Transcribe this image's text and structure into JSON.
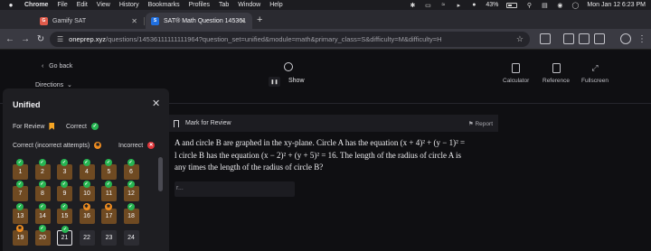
{
  "menubar": {
    "app": "Chrome",
    "items": [
      "File",
      "Edit",
      "View",
      "History",
      "Bookmarks",
      "Profiles",
      "Tab",
      "Window",
      "Help"
    ],
    "battery": "43%",
    "clock": "Mon Jan 12  6:23 PM"
  },
  "tabs": [
    {
      "title": "Gamify SAT",
      "favicon": "G"
    },
    {
      "title": "SAT® Math Question 145361",
      "favicon": "S"
    }
  ],
  "address": {
    "host": "oneprep.xyz",
    "path": "/questions/14536111111111964?question_set=unified&module=math&primary_class=S&difficulty=M&difficulty=H"
  },
  "page": {
    "back": "Go back",
    "directions": "Directions",
    "show": "Show",
    "tools": [
      {
        "icon": "calculator-icon",
        "label": "Calculator"
      },
      {
        "icon": "reference-icon",
        "label": "Reference"
      },
      {
        "icon": "fullscreen-icon",
        "label": "Fullscreen"
      }
    ],
    "mark_for_review": "Mark for Review",
    "report": "Report",
    "question_lines": [
      "A and circle B are graphed in the xy-plane. Circle A has the equation (x + 4)² + (y − 1)² =",
      "l circle B has the equation (x − 2)² + (y + 5)² = 16. The length of the radius of circle A is",
      "any times the length of the radius of circle B?"
    ],
    "answer_placeholder": "r..."
  },
  "panel": {
    "title": "Unified",
    "legend": {
      "for_review": "For Review",
      "correct": "Correct",
      "correct_incorrect_attempts": "Correct (incorrect attempts)",
      "incorrect": "Incorrect"
    },
    "questions": [
      {
        "n": "1",
        "status": "correct"
      },
      {
        "n": "2",
        "status": "correct"
      },
      {
        "n": "3",
        "status": "correct"
      },
      {
        "n": "4",
        "status": "correct"
      },
      {
        "n": "5",
        "status": "correct"
      },
      {
        "n": "6",
        "status": "correct"
      },
      {
        "n": "7",
        "status": "correct"
      },
      {
        "n": "8",
        "status": "correct"
      },
      {
        "n": "9",
        "status": "correct"
      },
      {
        "n": "10",
        "status": "correct"
      },
      {
        "n": "11",
        "status": "correct"
      },
      {
        "n": "12",
        "status": "correct"
      },
      {
        "n": "13",
        "status": "correct"
      },
      {
        "n": "14",
        "status": "correct"
      },
      {
        "n": "15",
        "status": "correct"
      },
      {
        "n": "16",
        "status": "correct-incorrect-attempts"
      },
      {
        "n": "17",
        "status": "correct-incorrect-attempts"
      },
      {
        "n": "18",
        "status": "correct"
      },
      {
        "n": "19",
        "status": "correct-incorrect-attempts"
      },
      {
        "n": "20",
        "status": "correct"
      },
      {
        "n": "21",
        "status": "current"
      },
      {
        "n": "22",
        "status": "unanswered"
      },
      {
        "n": "23",
        "status": "unanswered"
      },
      {
        "n": "24",
        "status": "unanswered"
      }
    ]
  },
  "colors": {
    "correct": "#27b552",
    "correct_incorrect_attempts": "#f08d21",
    "incorrect": "#e0363b",
    "for_review": "#f5a524"
  }
}
